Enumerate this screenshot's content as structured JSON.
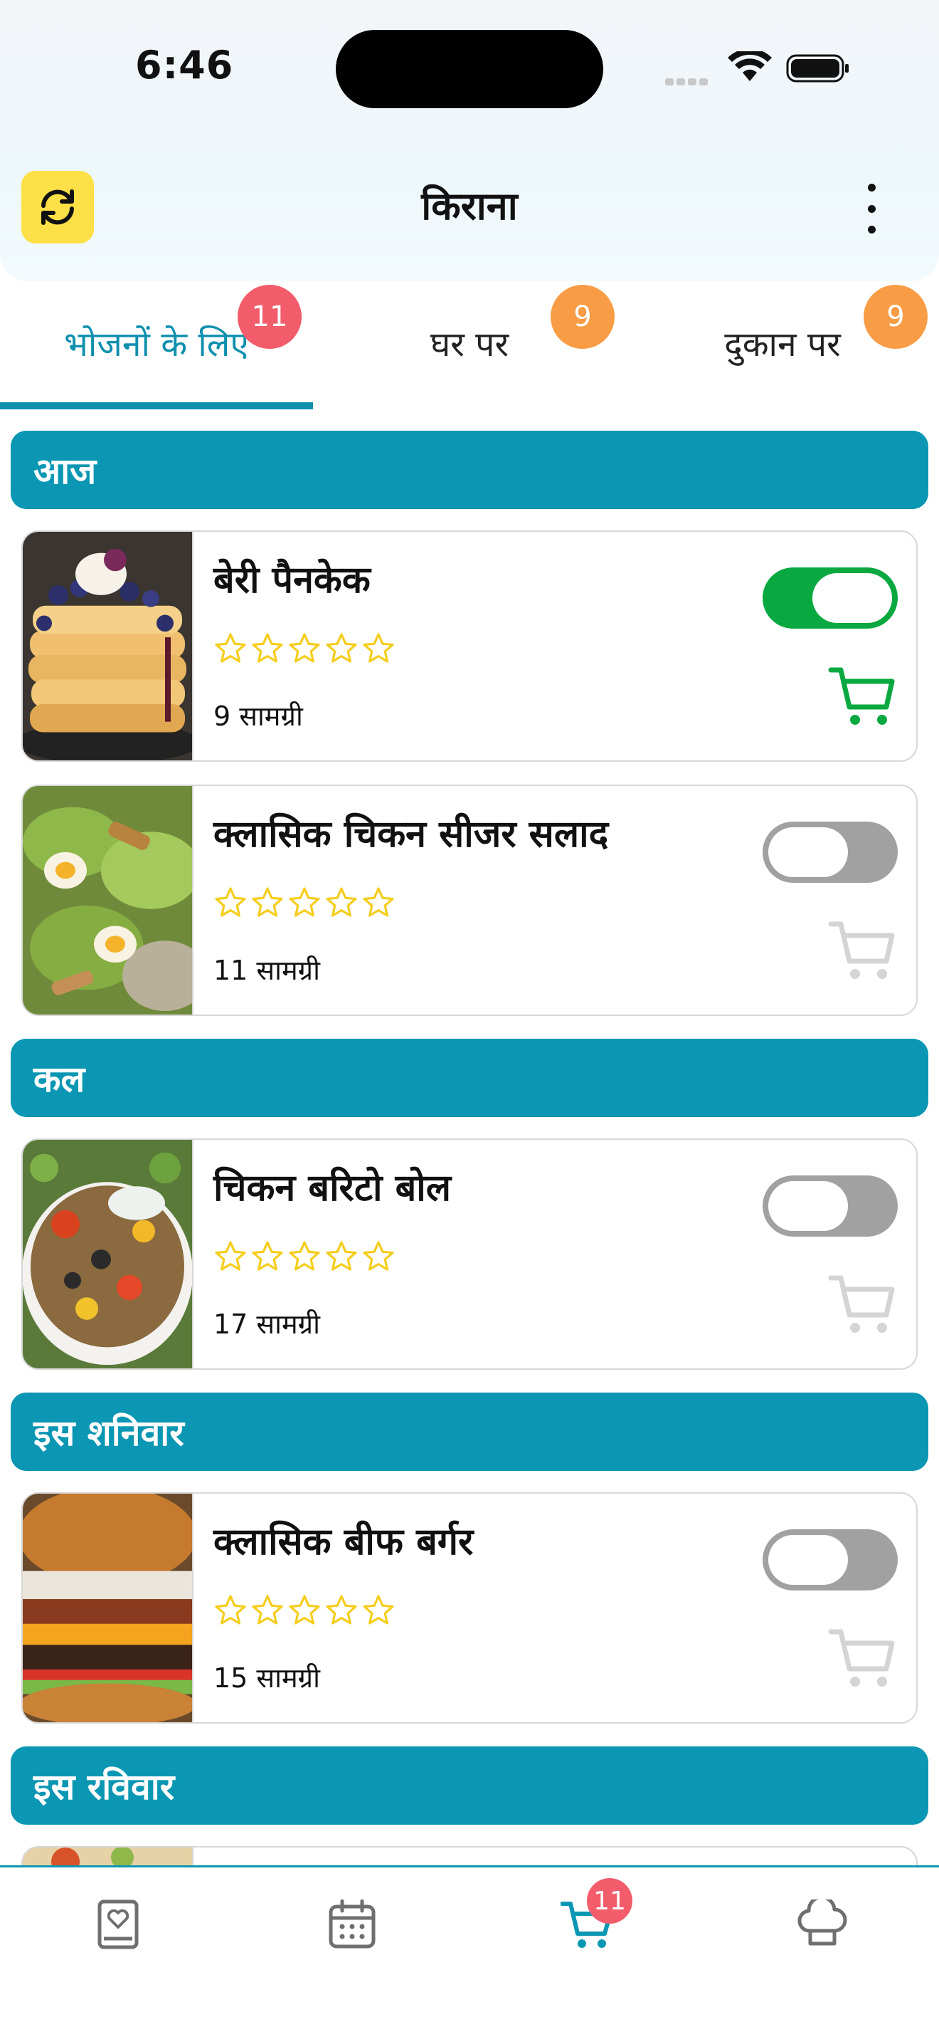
{
  "status_bar": {
    "time": "6:46"
  },
  "header": {
    "title": "किराना"
  },
  "tabs": [
    {
      "label": "भोजनों के लिए",
      "badge": "11",
      "badge_color": "#f25c6b",
      "active": true
    },
    {
      "label": "घर पर",
      "badge": "9",
      "badge_color": "#f89c45",
      "active": false
    },
    {
      "label": "दुकान पर",
      "badge": "9",
      "badge_color": "#f89c45",
      "active": false
    }
  ],
  "sections": [
    {
      "day": "आज",
      "recipes": [
        {
          "name": "बेरी पैनकेक",
          "ingredients": "9 सामग्री",
          "rating": 0,
          "in_cart": true
        },
        {
          "name": "क्लासिक चिकन सीजर सलाद",
          "ingredients": "11 सामग्री",
          "rating": 0,
          "in_cart": false
        }
      ]
    },
    {
      "day": "कल",
      "recipes": [
        {
          "name": "चिकन बरिटो बोल",
          "ingredients": "17 सामग्री",
          "rating": 0,
          "in_cart": false
        }
      ]
    },
    {
      "day": "इस शनिवार",
      "recipes": [
        {
          "name": "क्लासिक बीफ बर्गर",
          "ingredients": "15 सामग्री",
          "rating": 0,
          "in_cart": false
        }
      ]
    },
    {
      "day": "इस रविवार",
      "recipes": []
    }
  ],
  "bottom_nav": {
    "items": [
      "recipe-book-icon",
      "calendar-icon",
      "cart-icon",
      "chef-hat-icon"
    ],
    "active": "cart-icon",
    "cart_badge": "11"
  },
  "colors": {
    "accent": "#0b97b3",
    "toggle_on": "#09a840",
    "toggle_off": "#a1a1a1",
    "star": "#f5cd1c",
    "refresh_bg": "#fde047"
  }
}
